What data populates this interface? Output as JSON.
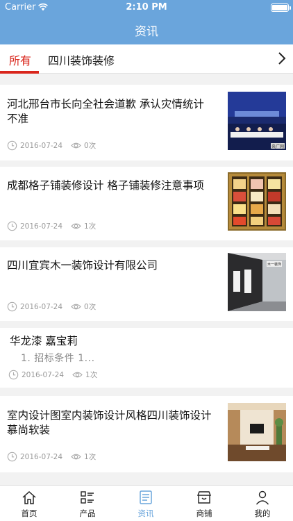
{
  "status_bar": {
    "carrier": "Carrier",
    "time": "2:10 PM"
  },
  "nav": {
    "title": "资讯"
  },
  "tabs": [
    {
      "label": "所有",
      "active": true
    },
    {
      "label": "四川装饰装修",
      "active": false
    }
  ],
  "articles": [
    {
      "title_line1": "河北邢台市长向全社会道歉 承认灾情统计",
      "title_line2": "不准",
      "date": "2016-07-24",
      "views": "0次",
      "thumb_caption": "央广网"
    },
    {
      "title_line1": "成都格子铺装修设计 格子铺装修注意事项",
      "date": "2016-07-24",
      "views": "1次"
    },
    {
      "title_line1": "四川宜宾木一装饰设计有限公司",
      "date": "2016-07-24",
      "views": "0次",
      "thumb_caption": "木一装饰"
    },
    {
      "title_line1": "华龙漆 嘉宝莉",
      "excerpt": "1.   招标条件     1...",
      "date": "2016-07-24",
      "views": "1次"
    },
    {
      "title_line1": "室内设计图室内装饰设计风格四川装饰设计",
      "title_line2": "慕尚软装",
      "date": "2016-07-24",
      "views": "1次"
    }
  ],
  "tab_bar": [
    {
      "label": "首页",
      "icon": "home-icon"
    },
    {
      "label": "产品",
      "icon": "list-icon"
    },
    {
      "label": "资讯",
      "icon": "news-icon",
      "active": true
    },
    {
      "label": "商铺",
      "icon": "shop-icon"
    },
    {
      "label": "我的",
      "icon": "user-icon"
    }
  ],
  "colors": {
    "accent": "#6aa5dc",
    "tab_active": "#d9261c",
    "meta_text": "#999999"
  }
}
